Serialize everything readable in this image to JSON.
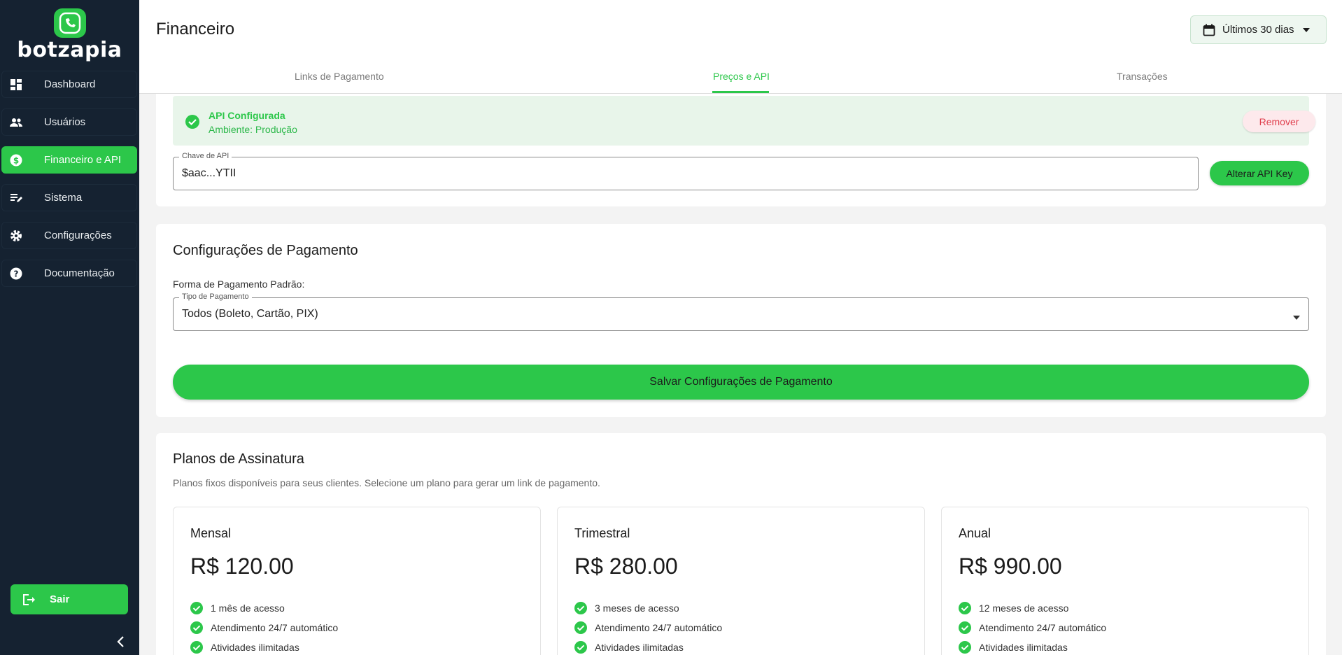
{
  "brand": {
    "name": "botzapia"
  },
  "sidebar": {
    "items": [
      {
        "label": "Dashboard",
        "icon": "dashboard-icon"
      },
      {
        "label": "Usuários",
        "icon": "users-icon"
      },
      {
        "label": "Financeiro e API",
        "icon": "dollar-icon"
      },
      {
        "label": "Sistema",
        "icon": "edit-list-icon"
      },
      {
        "label": "Configurações",
        "icon": "gear-icon"
      },
      {
        "label": "Documentação",
        "icon": "help-icon"
      }
    ],
    "logout_label": "Sair"
  },
  "header": {
    "title": "Financeiro",
    "date_filter": "Últimos 30 dias",
    "tabs": [
      {
        "label": "Links de Pagamento"
      },
      {
        "label": "Preços e API"
      },
      {
        "label": "Transações"
      }
    ]
  },
  "api": {
    "status_title": "API Configurada",
    "status_env": "Ambiente: Produção",
    "remove_label": "Remover",
    "key_label": "Chave de API",
    "key_value": "$aac...YTII",
    "change_label": "Alterar API Key"
  },
  "payment": {
    "title": "Configurações de Pagamento",
    "default_label": "Forma de Pagamento Padrão:",
    "type_label": "Tipo de Pagamento",
    "type_value": "Todos (Boleto, Cartão, PIX)",
    "save_label": "Salvar Configurações de Pagamento"
  },
  "plans": {
    "title": "Planos de Assinatura",
    "subtitle": "Planos fixos disponíveis para seus clientes. Selecione um plano para gerar um link de pagamento.",
    "items": [
      {
        "name": "Mensal",
        "price": "R$ 120.00",
        "features": [
          "1 mês de acesso",
          "Atendimento 24/7 automático",
          "Atividades ilimitadas"
        ]
      },
      {
        "name": "Trimestral",
        "price": "R$ 280.00",
        "features": [
          "3 meses de acesso",
          "Atendimento 24/7 automático",
          "Atividades ilimitadas"
        ]
      },
      {
        "name": "Anual",
        "price": "R$ 990.00",
        "features": [
          "12 meses de acesso",
          "Atendimento 24/7 automático",
          "Atividades ilimitadas"
        ]
      }
    ]
  },
  "colors": {
    "accent": "#2cc74a",
    "sidebar": "#152231",
    "danger": "#e0404e"
  }
}
